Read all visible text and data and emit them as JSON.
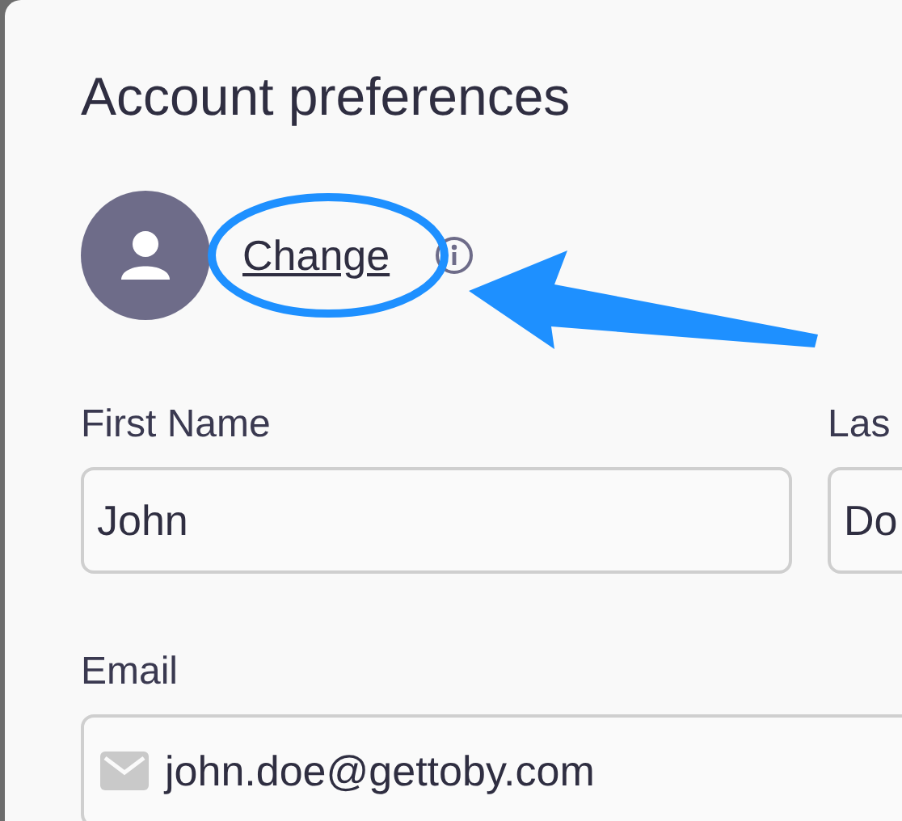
{
  "dialog": {
    "title": "Account preferences"
  },
  "avatar": {
    "action": "Change"
  },
  "fields": [
    {
      "label": "First Name",
      "value": "John",
      "kind": "text"
    },
    {
      "label": "Las",
      "value": "Do",
      "kind": "text"
    },
    {
      "label": "Email",
      "value": "john.doe@gettoby.com",
      "kind": "email"
    }
  ]
}
